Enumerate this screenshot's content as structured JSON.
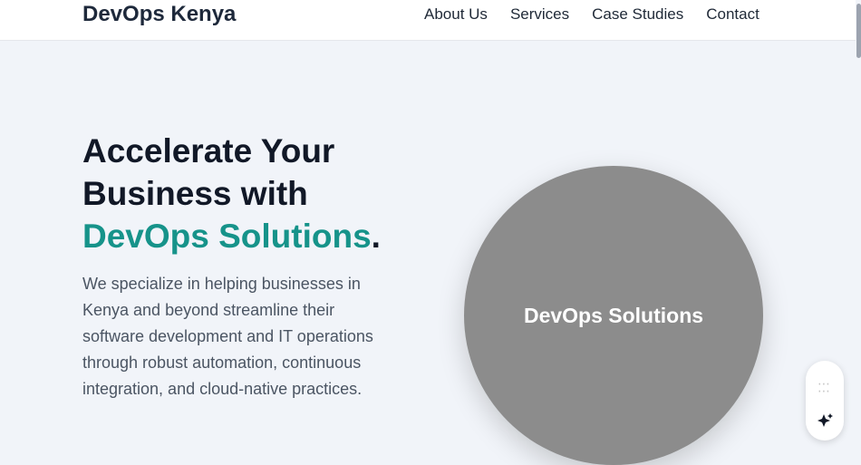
{
  "header": {
    "brand": "DevOps Kenya",
    "nav": [
      "About Us",
      "Services",
      "Case Studies",
      "Contact"
    ]
  },
  "hero": {
    "title_line1": "Accelerate Your",
    "title_line2": "Business with",
    "title_accent": "DevOps Solutions",
    "title_period": ".",
    "description": "We specialize in helping businesses in Kenya and beyond streamline their software development and IT operations through robust automation, continuous integration, and cloud-native practices."
  },
  "image": {
    "label": "DevOps Solutions"
  },
  "colors": {
    "accent": "#16938a",
    "circle": "#8c8c8c",
    "background": "#f1f4f9"
  },
  "icons": {
    "widget_top": "drag-dots-icon",
    "widget_bottom": "sparkle-icon"
  }
}
